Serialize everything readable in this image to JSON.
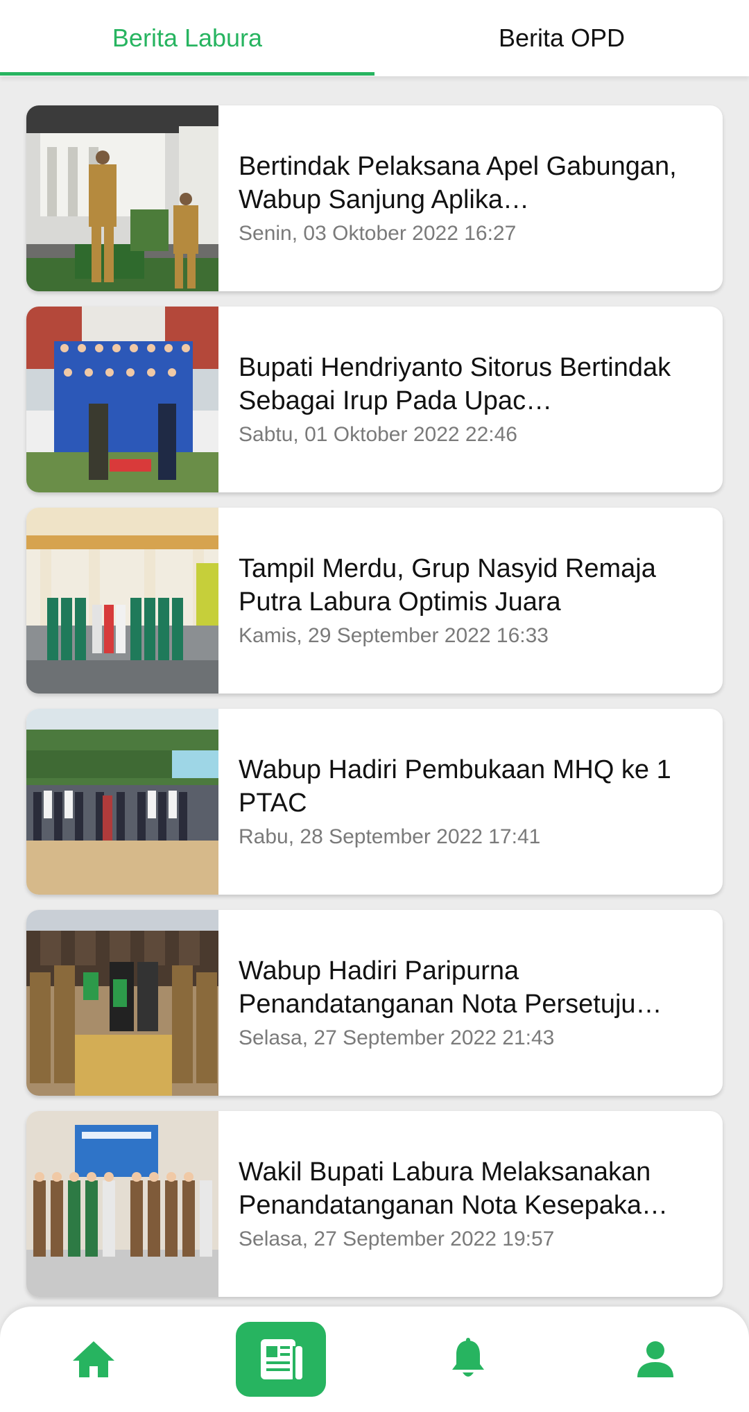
{
  "tabs": {
    "active": "Berita Labura",
    "items": [
      {
        "label": "Berita Labura"
      },
      {
        "label": "Berita OPD"
      }
    ]
  },
  "news": [
    {
      "title": "Bertindak Pelaksana Apel Gabungan, Wabup Sanjung Aplika…",
      "date": "Senin, 03 Oktober 2022 16:27"
    },
    {
      "title": "Bupati Hendriyanto Sitorus Bertindak Sebagai Irup Pada Upac…",
      "date": "Sabtu, 01 Oktober 2022 22:46"
    },
    {
      "title": "Tampil Merdu, Grup Nasyid Remaja Putra Labura Optimis Juara",
      "date": "Kamis, 29 September 2022 16:33"
    },
    {
      "title": "Wabup Hadiri Pembukaan MHQ ke 1 PTAC",
      "date": "Rabu, 28 September 2022 17:41"
    },
    {
      "title": "Wabup Hadiri Paripurna Penandatanganan Nota Persetuju…",
      "date": "Selasa, 27 September 2022 21:43"
    },
    {
      "title": "Wakil Bupati Labura Melaksanakan Penandatanganan Nota Kesepaka…",
      "date": "Selasa, 27 September 2022 19:57"
    }
  ],
  "bottom_nav": {
    "active": "news",
    "items": [
      {
        "icon": "home-icon"
      },
      {
        "icon": "newspaper-icon"
      },
      {
        "icon": "bell-icon"
      },
      {
        "icon": "person-icon"
      }
    ]
  },
  "colors": {
    "accent": "#27b460",
    "background": "#ececec",
    "date_text": "#7a7a7a"
  }
}
